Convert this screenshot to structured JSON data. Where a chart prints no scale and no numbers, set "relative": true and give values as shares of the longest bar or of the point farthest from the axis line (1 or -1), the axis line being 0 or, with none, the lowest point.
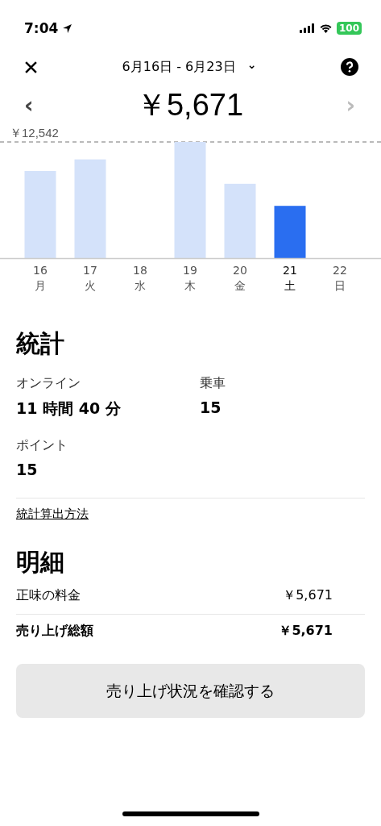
{
  "status_bar": {
    "time": "7:04",
    "battery": "100"
  },
  "header": {
    "date_range": "6月16日 - 6月23日",
    "chevron": "⌄"
  },
  "total": {
    "prev": "‹",
    "amount": "￥5,671",
    "next": "›"
  },
  "chart_data": {
    "type": "bar",
    "relative": true,
    "categories": [
      "16 月",
      "17 火",
      "18 水",
      "19 木",
      "20 金",
      "21 土",
      "22 日"
    ],
    "values": [
      0.75,
      0.85,
      0,
      1,
      0.64,
      0.45,
      0
    ],
    "annotations": [
      "￥12,542"
    ]
  },
  "days": [
    {
      "selected": false
    },
    {
      "selected": false
    },
    {
      "selected": false
    },
    {
      "selected": false
    },
    {
      "selected": false
    },
    {
      "selected": true
    },
    {
      "selected": false
    }
  ],
  "stats": {
    "title": "統計",
    "items": [
      {
        "label": "オンライン",
        "value": "11 時間 40 分"
      },
      {
        "label": "乗車",
        "value": "15"
      },
      {
        "label": "ポイント",
        "value": "15"
      }
    ],
    "link": "統計算出方法"
  },
  "breakdown": {
    "title": "明細",
    "rows": [
      {
        "label": "正味の料金",
        "value": "￥5,671",
        "bold": false
      },
      {
        "label": "売り上げ総額",
        "value": "￥5,671",
        "bold": true
      }
    ]
  },
  "button": "売り上げ状況を確認する"
}
